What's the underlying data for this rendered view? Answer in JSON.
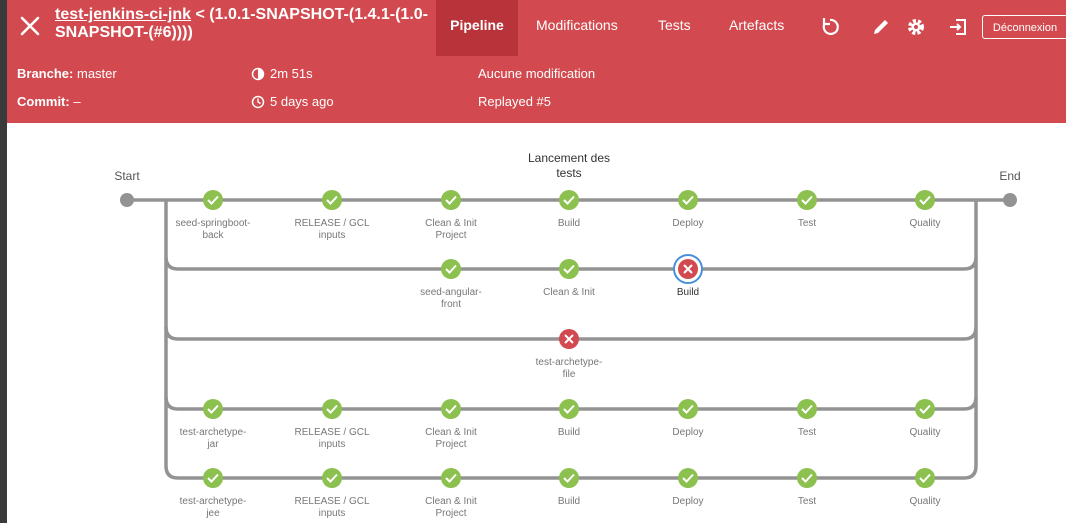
{
  "header": {
    "job_name": "test-jenkins-ci-jnk",
    "run_name": "< (1.0.1-SNAPSHOT-(1.4.1-(1.0-SNAPSHOT-(#6))))",
    "tabs": [
      {
        "label": "Pipeline",
        "active": true
      },
      {
        "label": "Modifications",
        "active": false
      },
      {
        "label": "Tests",
        "active": false
      },
      {
        "label": "Artefacts",
        "active": false
      }
    ],
    "icons": [
      "replay-icon",
      "edit-icon",
      "settings-icon",
      "logout-icon"
    ],
    "logout_label": "Déconnexion"
  },
  "info": {
    "branch_label": "Branche:",
    "branch_value": "master",
    "commit_label": "Commit:",
    "commit_value": "–",
    "duration": "2m 51s",
    "started": "5 days ago",
    "changes": "Aucune modification",
    "cause": "Replayed #5"
  },
  "pipeline": {
    "start_label": "Start",
    "end_label": "End",
    "stage_title": "Lancement des tests",
    "colors": {
      "success": "#8cc04f",
      "failed": "#d24a4f",
      "line": "#949393",
      "selected_ring": "#4a90d9"
    },
    "branches": [
      {
        "stages": [
          {
            "label": "seed-springboot-back",
            "status": "success"
          },
          {
            "label": "RELEASE / GCL inputs",
            "status": "success"
          },
          {
            "label": "Clean & Init Project",
            "status": "success"
          },
          {
            "label": "Build",
            "status": "success"
          },
          {
            "label": "Deploy",
            "status": "success"
          },
          {
            "label": "Test",
            "status": "success"
          },
          {
            "label": "Quality",
            "status": "success"
          }
        ]
      },
      {
        "stages": [
          {
            "label": "seed-angular-front",
            "status": "success"
          },
          {
            "label": "Clean & Init",
            "status": "success"
          },
          {
            "label": "Build",
            "status": "failed",
            "selected": true
          }
        ]
      },
      {
        "stages": [
          {
            "label": "test-archetype-file",
            "status": "failed"
          }
        ]
      },
      {
        "stages": [
          {
            "label": "test-archetype-jar",
            "status": "success"
          },
          {
            "label": "RELEASE / GCL inputs",
            "status": "success"
          },
          {
            "label": "Clean & Init Project",
            "status": "success"
          },
          {
            "label": "Build",
            "status": "success"
          },
          {
            "label": "Deploy",
            "status": "success"
          },
          {
            "label": "Test",
            "status": "success"
          },
          {
            "label": "Quality",
            "status": "success"
          }
        ]
      },
      {
        "stages": [
          {
            "label": "test-archetype-jee",
            "status": "success"
          },
          {
            "label": "RELEASE / GCL inputs",
            "status": "success"
          },
          {
            "label": "Clean & Init Project",
            "status": "success"
          },
          {
            "label": "Build",
            "status": "success"
          },
          {
            "label": "Deploy",
            "status": "success"
          },
          {
            "label": "Test",
            "status": "success"
          },
          {
            "label": "Quality",
            "status": "success"
          }
        ]
      }
    ]
  }
}
